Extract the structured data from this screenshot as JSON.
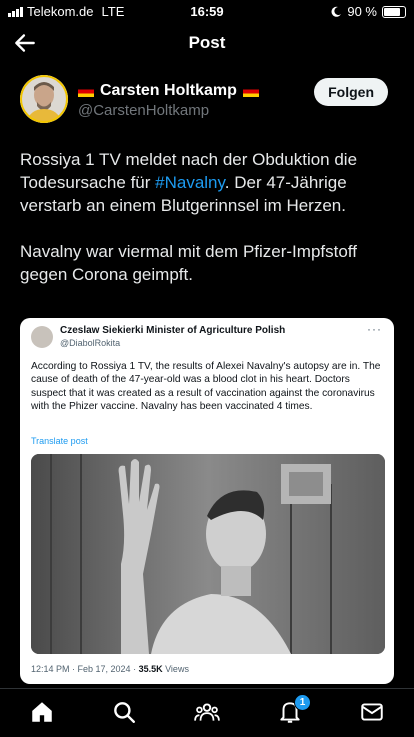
{
  "status": {
    "carrier": "Telekom.de",
    "network": "LTE",
    "time": "16:59",
    "battery_text": "90 %",
    "battery_level": 0.9
  },
  "header": {
    "title": "Post",
    "back_icon": "arrow-left-icon"
  },
  "author": {
    "name": "Carsten Holtkamp",
    "handle": "@CarstenHoltkamp",
    "follow_label": "Folgen"
  },
  "post": {
    "line1_before": "Rossiya 1 TV meldet nach der Obduktion die Todesursache für ",
    "hashtag": "#Navalny",
    "line1_after": ". Der 47-Jährige verstarb an einem Blutgerinnsel im Herzen.",
    "paragraph2": "Navalny war viermal mit dem Pfizer-Impfstoff gegen Corona geimpft."
  },
  "quote": {
    "name": "Czeslaw Siekierki Minister of Agriculture Polish",
    "handle": "@DiabolRokita",
    "more": "···",
    "text": "According to Rossiya 1 TV, the results of Alexei Navalny's autopsy are in. The cause of death of the 47-year-old was a blood clot in his heart. Doctors suspect that it was created as a result of vaccination against the coronavirus with the Phizer vaccine. Navalny has been vaccinated 4 times.",
    "translate": "Translate post",
    "timestamp": "12:14 PM · Feb 17, 2024 · ",
    "views_count": "35.5K",
    "views_label": " Views"
  },
  "tabs": {
    "items": [
      "home-icon",
      "search-icon",
      "communities-icon",
      "notifications-icon",
      "messages-icon"
    ],
    "notification_badge": "1",
    "accent": "#1d9bf0"
  }
}
